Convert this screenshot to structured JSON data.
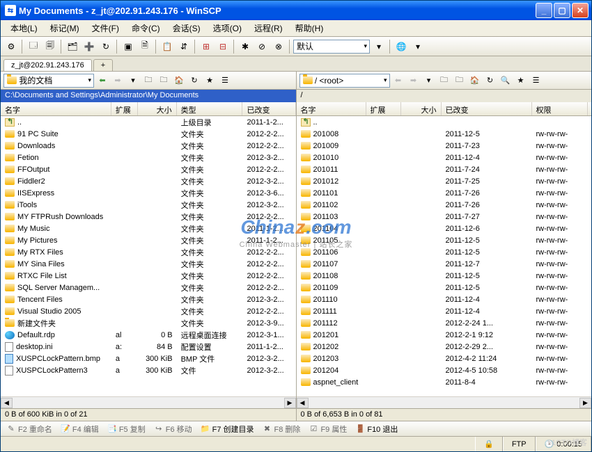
{
  "title": "My Documents - z_jt@202.91.243.176 - WinSCP",
  "menu": [
    "本地(L)",
    "标记(M)",
    "文件(F)",
    "命令(C)",
    "会话(S)",
    "选项(O)",
    "远程(R)",
    "帮助(H)"
  ],
  "toolbar": {
    "preset": "默认"
  },
  "tab": {
    "active": "z_jt@202.91.243.176",
    "new": "+"
  },
  "left": {
    "selector_icon": "folder",
    "selector": "我的文档",
    "path": "C:\\Documents and Settings\\Administrator\\My Documents",
    "columns": {
      "name": "名字",
      "ext": "扩展",
      "size": "大小",
      "type": "类型",
      "date": "已改变"
    },
    "status": "0 B of 600 KiB in 0 of 21",
    "rows": [
      {
        "icon": "up",
        "name": "..",
        "type": "上级目录",
        "date": "2011-1-2..."
      },
      {
        "icon": "folder",
        "name": "91 PC Suite",
        "type": "文件夹",
        "date": "2012-2-2..."
      },
      {
        "icon": "folder",
        "name": "Downloads",
        "type": "文件夹",
        "date": "2012-2-2..."
      },
      {
        "icon": "folder",
        "name": "Fetion",
        "type": "文件夹",
        "date": "2012-3-2..."
      },
      {
        "icon": "folder",
        "name": "FFOutput",
        "type": "文件夹",
        "date": "2012-2-2..."
      },
      {
        "icon": "folder",
        "name": "Fiddler2",
        "type": "文件夹",
        "date": "2012-3-2..."
      },
      {
        "icon": "folder",
        "name": "IISExpress",
        "type": "文件夹",
        "date": "2012-3-6..."
      },
      {
        "icon": "folder",
        "name": "iTools",
        "type": "文件夹",
        "date": "2012-3-2..."
      },
      {
        "icon": "folder",
        "name": "MY FTPRush Downloads",
        "type": "文件夹",
        "date": "2012-2-2..."
      },
      {
        "icon": "folder",
        "name": "My Music",
        "type": "文件夹",
        "date": "2011-1-2..."
      },
      {
        "icon": "folder",
        "name": "My Pictures",
        "type": "文件夹",
        "date": "2011-1-2..."
      },
      {
        "icon": "folder",
        "name": "My RTX Files",
        "type": "文件夹",
        "date": "2012-2-2..."
      },
      {
        "icon": "folder",
        "name": "MY Sina Files",
        "type": "文件夹",
        "date": "2012-2-2..."
      },
      {
        "icon": "folder",
        "name": "RTXC File List",
        "type": "文件夹",
        "date": "2012-2-2..."
      },
      {
        "icon": "folder",
        "name": "SQL Server Managem...",
        "type": "文件夹",
        "date": "2012-2-2..."
      },
      {
        "icon": "folder",
        "name": "Tencent Files",
        "type": "文件夹",
        "date": "2012-3-2..."
      },
      {
        "icon": "folder",
        "name": "Visual Studio 2005",
        "type": "文件夹",
        "date": "2012-2-2..."
      },
      {
        "icon": "folder",
        "name": "新建文件夹",
        "type": "文件夹",
        "date": "2012-3-9..."
      },
      {
        "icon": "rdp",
        "name": "Default.rdp",
        "size": "0 B",
        "type": "远程桌面连接",
        "date": "2012-3-1...",
        "ext": "al"
      },
      {
        "icon": "ini",
        "name": "desktop.ini",
        "size": "84 B",
        "type": "配置设置",
        "date": "2011-1-2...",
        "ext": "a:"
      },
      {
        "icon": "bmp",
        "name": "XUSPCLockPattern.bmp",
        "size": "300 KiB",
        "type": "BMP 文件",
        "date": "2012-3-2...",
        "ext": "a"
      },
      {
        "icon": "file",
        "name": "XUSPCLockPattern3",
        "size": "300 KiB",
        "type": "文件",
        "date": "2012-3-2...",
        "ext": "a"
      }
    ]
  },
  "right": {
    "selector_icon": "folder",
    "selector": "/ <root>",
    "path": "/",
    "columns": {
      "name": "名字",
      "ext": "扩展",
      "size": "大小",
      "date": "已改变",
      "perm": "权限"
    },
    "status": "0 B of 6,653 B in 0 of 81",
    "rows": [
      {
        "icon": "up",
        "name": ".."
      },
      {
        "icon": "folder",
        "name": "201008",
        "date": "2011-12-5",
        "perm": "rw-rw-rw-"
      },
      {
        "icon": "folder",
        "name": "201009",
        "date": "2011-7-23",
        "perm": "rw-rw-rw-"
      },
      {
        "icon": "folder",
        "name": "201010",
        "date": "2011-12-4",
        "perm": "rw-rw-rw-"
      },
      {
        "icon": "folder",
        "name": "201011",
        "date": "2011-7-24",
        "perm": "rw-rw-rw-"
      },
      {
        "icon": "folder",
        "name": "201012",
        "date": "2011-7-25",
        "perm": "rw-rw-rw-"
      },
      {
        "icon": "folder",
        "name": "201101",
        "date": "2011-7-26",
        "perm": "rw-rw-rw-"
      },
      {
        "icon": "folder",
        "name": "201102",
        "date": "2011-7-26",
        "perm": "rw-rw-rw-"
      },
      {
        "icon": "folder",
        "name": "201103",
        "date": "2011-7-27",
        "perm": "rw-rw-rw-"
      },
      {
        "icon": "folder",
        "name": "201104",
        "date": "2011-12-6",
        "perm": "rw-rw-rw-"
      },
      {
        "icon": "folder",
        "name": "201105",
        "date": "2011-12-5",
        "perm": "rw-rw-rw-"
      },
      {
        "icon": "folder",
        "name": "201106",
        "date": "2011-12-5",
        "perm": "rw-rw-rw-"
      },
      {
        "icon": "folder",
        "name": "201107",
        "date": "2011-12-7",
        "perm": "rw-rw-rw-"
      },
      {
        "icon": "folder",
        "name": "201108",
        "date": "2011-12-5",
        "perm": "rw-rw-rw-"
      },
      {
        "icon": "folder",
        "name": "201109",
        "date": "2011-12-5",
        "perm": "rw-rw-rw-"
      },
      {
        "icon": "folder",
        "name": "201110",
        "date": "2011-12-4",
        "perm": "rw-rw-rw-"
      },
      {
        "icon": "folder",
        "name": "201111",
        "date": "2011-12-4",
        "perm": "rw-rw-rw-"
      },
      {
        "icon": "folder",
        "name": "201112",
        "date": "2012-2-24 1...",
        "perm": "rw-rw-rw-"
      },
      {
        "icon": "folder",
        "name": "201201",
        "date": "2012-2-1 9:12",
        "perm": "rw-rw-rw-"
      },
      {
        "icon": "folder",
        "name": "201202",
        "date": "2012-2-29 2...",
        "perm": "rw-rw-rw-"
      },
      {
        "icon": "folder",
        "name": "201203",
        "date": "2012-4-2 11:24",
        "perm": "rw-rw-rw-"
      },
      {
        "icon": "folder",
        "name": "201204",
        "date": "2012-4-5 10:58",
        "perm": "rw-rw-rw-"
      },
      {
        "icon": "folder",
        "name": "aspnet_client",
        "date": "2011-8-4",
        "perm": "rw-rw-rw-"
      }
    ]
  },
  "fkeys": {
    "f2": "F2 重命名",
    "f4": "F4 编辑",
    "f5": "F5 复制",
    "f6": "F6 移动",
    "f7": "F7 创建目录",
    "f8": "F8 删除",
    "f9": "F9 属性",
    "f10": "F10 退出"
  },
  "statusbar": {
    "protocol": "FTP",
    "time": "0:00:15",
    "lock": "🔒"
  },
  "watermark": {
    "main": "Chinaz.com",
    "sub": "China Webmaster | 站长之家"
  },
  "blog_wm": "51CTO博客"
}
